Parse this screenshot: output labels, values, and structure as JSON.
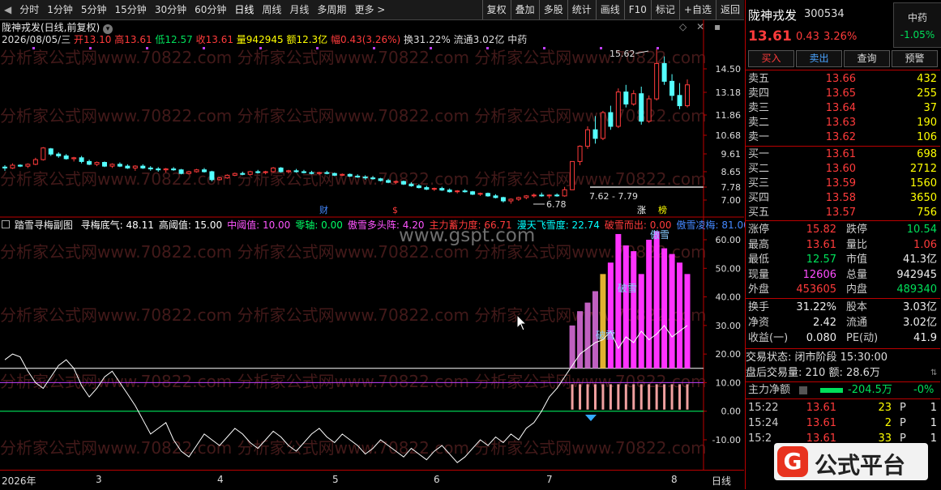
{
  "toolbar": {
    "periods": [
      "分时",
      "1分钟",
      "5分钟",
      "15分钟",
      "30分钟",
      "60分钟",
      "日线",
      "周线",
      "月线",
      "多周期",
      "更多"
    ],
    "tools": [
      "复权",
      "叠加",
      "多股",
      "统计",
      "画线",
      "F10",
      "标记",
      "+自选",
      "返回"
    ]
  },
  "info": {
    "stock_title": "陇神戎发(日线,前复权)",
    "date": "2026/08/05/三",
    "open": "开13.10",
    "high": "高13.61",
    "low": "低12.57",
    "close": "收13.61",
    "volume": "量942945",
    "amount": "额12.3亿",
    "change": "幅0.43(3.26%)",
    "turnover": "换31.22%",
    "float": "流通3.02亿",
    "sector": "中药"
  },
  "main_chart": {
    "y_ticks": [
      "14.50",
      "13.18",
      "11.86",
      "10.68",
      "9.61",
      "8.65",
      "7.78",
      "7.00"
    ],
    "high_label": "15.62",
    "low_label": "6.78",
    "range_label": "7.62 - 7.79",
    "markers": [
      "财",
      "$",
      "涨",
      "榜"
    ]
  },
  "indicator": {
    "name": "踏雪寻梅副图",
    "items": [
      {
        "text": "寻梅底气: 48.11",
        "color": "#ffffff"
      },
      {
        "text": "高阈值: 15.00",
        "color": "#ffffff"
      },
      {
        "text": "中阈值: 10.00",
        "color": "#ff55ff"
      },
      {
        "text": "零轴: 0.00",
        "color": "#00ff66"
      },
      {
        "text": "傲雪多头阵: 4.20",
        "color": "#ff55ff"
      },
      {
        "text": "主力蓄力度: 66.71",
        "color": "#ff3b3b"
      },
      {
        "text": "漫天飞雪度: 22.74",
        "color": "#00ffff"
      },
      {
        "text": "破雪而出: 0.00",
        "color": "#ff3b3b"
      },
      {
        "text": "傲雪凌梅: 81.00",
        "color": "#4488ff"
      }
    ],
    "y_ticks": [
      "60.00",
      "50.00",
      "40.00",
      "30.00",
      "20.00",
      "10.00",
      "0.00",
      "-10.00"
    ],
    "labels": [
      "破雪",
      "破雪",
      "傲雪"
    ]
  },
  "x_axis": {
    "labels": [
      "2026年",
      "3",
      "4",
      "5",
      "6",
      "7",
      "8"
    ],
    "period": "日线"
  },
  "watermark": {
    "site": "www.gspt.com",
    "mark": "分析家公式网www.70822.com",
    "logo": "公式平台"
  },
  "right": {
    "name": "陇神戎发",
    "code": "300534",
    "sector": "中药",
    "sector_pct": "-1.05%",
    "price": "13.61",
    "change": "0.43",
    "pct": "3.26%",
    "buttons": [
      "买入",
      "卖出",
      "查询",
      "预警"
    ],
    "asks": [
      [
        "卖五",
        "13.66",
        "432"
      ],
      [
        "卖四",
        "13.65",
        "255"
      ],
      [
        "卖三",
        "13.64",
        "37"
      ],
      [
        "卖二",
        "13.63",
        "190"
      ],
      [
        "卖一",
        "13.62",
        "106"
      ]
    ],
    "bids": [
      [
        "买一",
        "13.61",
        "698"
      ],
      [
        "买二",
        "13.60",
        "2712"
      ],
      [
        "买三",
        "13.59",
        "1560"
      ],
      [
        "买四",
        "13.58",
        "3650"
      ],
      [
        "买五",
        "13.57",
        "756"
      ]
    ],
    "stats": [
      [
        "涨停",
        "15.82",
        "red",
        "跌停",
        "10.54",
        "green"
      ],
      [
        "最高",
        "13.61",
        "red",
        "量比",
        "1.06",
        "red"
      ],
      [
        "最低",
        "12.57",
        "green",
        "市值",
        "41.3亿",
        "white"
      ],
      [
        "现量",
        "12606",
        "mag",
        "总量",
        "942945",
        "white"
      ],
      [
        "外盘",
        "453605",
        "red",
        "内盘",
        "489340",
        "green"
      ]
    ],
    "stats2": [
      [
        "换手",
        "31.22%",
        "股本",
        "3.03亿"
      ],
      [
        "净资",
        "2.42",
        "流通",
        "3.02亿"
      ],
      [
        "收益(一)",
        "0.080",
        "PE(动)",
        "41.9"
      ]
    ],
    "trade_status": "交易状态: 闭市阶段 15:30:00",
    "after_hours": "盘后交易量: 210  额: 28.6万",
    "net_flow_label": "主力净额",
    "net_flow": "-204.5万",
    "net_flow_pct": "-0%",
    "ticks": [
      [
        "15:22",
        "13.61",
        "23",
        "P",
        "1"
      ],
      [
        "15:24",
        "13.61",
        "2",
        "P",
        "1"
      ],
      [
        "15:2",
        "13.61",
        "33",
        "P",
        "1"
      ]
    ]
  },
  "candles": [
    [
      8.9,
      9.0,
      8.7,
      8.85
    ],
    [
      8.85,
      9.1,
      8.8,
      9.0
    ],
    [
      9.0,
      9.05,
      8.9,
      8.95
    ],
    [
      8.95,
      9.1,
      8.85,
      9.05
    ],
    [
      9.05,
      9.4,
      9.0,
      9.3
    ],
    [
      9.3,
      10.0,
      9.25,
      9.95
    ],
    [
      9.9,
      9.95,
      9.5,
      9.6
    ],
    [
      9.6,
      9.7,
      9.4,
      9.5
    ],
    [
      9.5,
      9.6,
      9.3,
      9.35
    ],
    [
      9.35,
      9.45,
      9.2,
      9.4
    ],
    [
      9.4,
      9.5,
      9.1,
      9.2
    ],
    [
      9.2,
      9.3,
      9.0,
      9.05
    ],
    [
      9.05,
      9.2,
      8.95,
      9.15
    ],
    [
      9.15,
      9.2,
      8.9,
      8.95
    ],
    [
      8.95,
      9.1,
      8.85,
      9.05
    ],
    [
      9.05,
      9.15,
      8.9,
      8.95
    ],
    [
      8.95,
      9.05,
      8.8,
      8.85
    ],
    [
      8.85,
      9.0,
      8.7,
      8.95
    ],
    [
      8.95,
      9.05,
      8.8,
      8.85
    ],
    [
      8.85,
      8.95,
      8.7,
      8.8
    ],
    [
      8.8,
      8.9,
      8.65,
      8.75
    ],
    [
      8.75,
      8.85,
      8.6,
      8.8
    ],
    [
      8.8,
      8.9,
      8.7,
      8.75
    ],
    [
      8.75,
      8.8,
      8.5,
      8.55
    ],
    [
      8.55,
      8.7,
      8.5,
      8.65
    ],
    [
      8.65,
      8.8,
      8.6,
      8.75
    ],
    [
      8.75,
      8.85,
      8.6,
      8.65
    ],
    [
      8.65,
      8.7,
      8.1,
      8.2
    ],
    [
      8.2,
      8.35,
      8.15,
      8.3
    ],
    [
      8.3,
      8.5,
      8.25,
      8.45
    ],
    [
      8.45,
      8.6,
      8.4,
      8.55
    ],
    [
      8.55,
      8.65,
      8.45,
      8.5
    ],
    [
      8.5,
      8.7,
      8.45,
      8.65
    ],
    [
      8.65,
      8.75,
      8.55,
      8.6
    ],
    [
      8.6,
      8.7,
      8.5,
      8.65
    ],
    [
      8.65,
      8.9,
      8.6,
      8.85
    ],
    [
      8.85,
      8.9,
      8.6,
      8.65
    ],
    [
      8.65,
      8.75,
      8.55,
      8.7
    ],
    [
      8.7,
      8.8,
      8.6,
      8.65
    ],
    [
      8.65,
      8.75,
      8.55,
      8.6
    ],
    [
      8.6,
      8.7,
      8.5,
      8.55
    ],
    [
      8.55,
      8.65,
      8.45,
      8.6
    ],
    [
      8.6,
      8.7,
      8.5,
      8.55
    ],
    [
      8.55,
      8.6,
      8.4,
      8.45
    ],
    [
      8.45,
      8.55,
      8.4,
      8.5
    ],
    [
      8.5,
      8.55,
      8.35,
      8.4
    ],
    [
      8.4,
      8.5,
      8.3,
      8.35
    ],
    [
      8.35,
      8.45,
      8.2,
      8.3
    ],
    [
      8.3,
      8.4,
      8.2,
      8.25
    ],
    [
      8.25,
      8.3,
      8.1,
      8.15
    ],
    [
      8.15,
      8.25,
      8.0,
      8.05
    ],
    [
      8.05,
      8.15,
      7.95,
      8.1
    ],
    [
      8.1,
      8.15,
      7.9,
      7.95
    ],
    [
      7.95,
      8.05,
      7.8,
      7.85
    ],
    [
      7.85,
      7.95,
      7.7,
      7.75
    ],
    [
      7.75,
      7.85,
      7.6,
      7.65
    ],
    [
      7.65,
      7.75,
      7.55,
      7.7
    ],
    [
      7.7,
      7.8,
      7.55,
      7.6
    ],
    [
      7.6,
      7.7,
      7.45,
      7.5
    ],
    [
      7.5,
      7.6,
      7.4,
      7.55
    ],
    [
      7.55,
      7.65,
      7.45,
      7.5
    ],
    [
      7.5,
      7.55,
      7.3,
      7.35
    ],
    [
      7.35,
      7.45,
      7.25,
      7.4
    ],
    [
      7.4,
      7.45,
      7.2,
      7.25
    ],
    [
      7.25,
      7.35,
      7.1,
      7.15
    ],
    [
      7.15,
      7.2,
      6.85,
      6.95
    ],
    [
      6.95,
      7.1,
      6.78,
      7.05
    ],
    [
      7.05,
      7.2,
      6.95,
      7.15
    ],
    [
      7.15,
      7.3,
      7.05,
      7.25
    ],
    [
      7.25,
      7.4,
      7.15,
      7.3
    ],
    [
      7.3,
      7.45,
      7.2,
      7.25
    ],
    [
      7.25,
      7.35,
      7.1,
      7.3
    ],
    [
      7.3,
      7.4,
      7.2,
      7.25
    ],
    [
      7.25,
      7.79,
      7.2,
      7.62
    ],
    [
      7.62,
      9.2,
      7.62,
      9.2
    ],
    [
      9.2,
      10.1,
      9.0,
      10.05
    ],
    [
      10.05,
      11.2,
      9.9,
      11.0
    ],
    [
      11.0,
      11.8,
      10.2,
      10.5
    ],
    [
      10.5,
      12.1,
      10.4,
      12.0
    ],
    [
      12.0,
      12.4,
      11.0,
      11.2
    ],
    [
      11.2,
      13.4,
      11.1,
      13.2
    ],
    [
      13.2,
      13.6,
      12.3,
      12.5
    ],
    [
      12.5,
      13.3,
      12.4,
      13.1
    ],
    [
      13.1,
      13.5,
      11.3,
      11.5
    ],
    [
      11.5,
      13.0,
      11.4,
      12.8
    ],
    [
      12.8,
      15.62,
      12.7,
      14.8
    ],
    [
      14.8,
      15.2,
      13.6,
      13.8
    ],
    [
      13.8,
      14.2,
      12.7,
      13.0
    ],
    [
      13.0,
      13.7,
      12.2,
      12.4
    ],
    [
      12.4,
      13.9,
      12.3,
      13.6
    ]
  ],
  "osc": [
    18,
    20,
    19,
    14,
    10,
    8,
    12,
    16,
    18,
    15,
    9,
    5,
    8,
    12,
    14,
    10,
    6,
    2,
    -3,
    -8,
    -6,
    -4,
    -10,
    -14,
    -16,
    -12,
    -8,
    -10,
    -12,
    -9,
    -6,
    -8,
    -11,
    -13,
    -10,
    -7,
    -9,
    -12,
    -14,
    -11,
    -8,
    -6,
    -9,
    -11,
    -8,
    -10,
    -12,
    -15,
    -13,
    -10,
    -12,
    -14,
    -16,
    -13,
    -15,
    -17,
    -14,
    -12,
    -15,
    -18,
    -16,
    -13,
    -10,
    -12,
    -9,
    -11,
    -8,
    -10,
    -6,
    -4,
    0,
    5,
    8,
    12,
    16,
    20,
    22,
    24,
    25,
    28,
    22,
    26,
    24,
    28,
    25,
    27,
    30,
    26,
    28,
    30
  ],
  "osc_bars": [
    0,
    0,
    0,
    0,
    0,
    0,
    0,
    0,
    0,
    0,
    0,
    0,
    0,
    0,
    0,
    0,
    0,
    0,
    0,
    0,
    0,
    0,
    0,
    0,
    0,
    0,
    0,
    0,
    0,
    0,
    0,
    0,
    0,
    0,
    0,
    0,
    0,
    0,
    0,
    0,
    0,
    0,
    0,
    0,
    0,
    0,
    0,
    0,
    0,
    0,
    0,
    0,
    0,
    0,
    0,
    0,
    0,
    0,
    0,
    0,
    0,
    0,
    0,
    0,
    0,
    0,
    0,
    0,
    0,
    0,
    0,
    0,
    0,
    0,
    30,
    35,
    38,
    42,
    48,
    52,
    62,
    58,
    56,
    48,
    60,
    63,
    57,
    55,
    52,
    48
  ]
}
